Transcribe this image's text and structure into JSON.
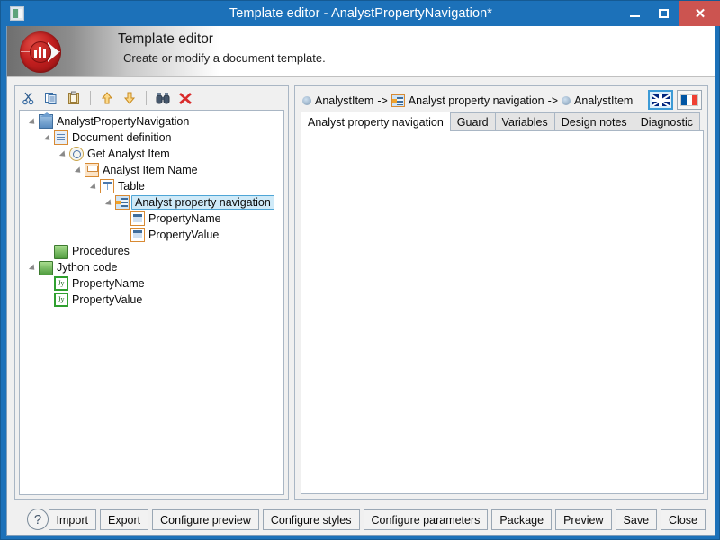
{
  "window": {
    "title": "Template editor - AnalystPropertyNavigation*",
    "icon": "app-icon",
    "minimize_label": "",
    "maximize_label": "",
    "close_label": "✕"
  },
  "banner": {
    "title": "Template editor",
    "subtitle": "Create or modify a document template.",
    "logo": "red-disc-logo"
  },
  "tree_toolbar": {
    "items": [
      {
        "name": "cut-icon",
        "glyph": "✂"
      },
      {
        "name": "copy-icon",
        "glyph": "⧉"
      },
      {
        "name": "paste-icon",
        "glyph": "Ὄb"
      },
      {
        "name": "move-up-icon",
        "glyph": "⇧"
      },
      {
        "name": "move-down-icon",
        "glyph": "⇩"
      },
      {
        "name": "find-icon",
        "glyph": "⚲"
      },
      {
        "name": "delete-icon",
        "glyph": "✖"
      }
    ]
  },
  "tree": {
    "nodes": [
      {
        "label": "AnalystPropertyNavigation",
        "depth": 0,
        "icon": "root-icon",
        "expanded": true,
        "selected": false
      },
      {
        "label": "Document definition",
        "depth": 1,
        "icon": "document-icon",
        "expanded": true,
        "selected": false
      },
      {
        "label": "Get Analyst Item",
        "depth": 2,
        "icon": "query-icon",
        "expanded": true,
        "selected": false
      },
      {
        "label": "Analyst Item Name",
        "depth": 3,
        "icon": "output-icon",
        "expanded": true,
        "selected": false
      },
      {
        "label": "Table",
        "depth": 4,
        "icon": "table-icon",
        "expanded": true,
        "selected": false
      },
      {
        "label": "Analyst property navigation",
        "depth": 5,
        "icon": "navigation-icon",
        "expanded": true,
        "selected": true
      },
      {
        "label": "PropertyName",
        "depth": 6,
        "icon": "field-icon",
        "expanded": false,
        "selected": false
      },
      {
        "label": "PropertyValue",
        "depth": 6,
        "icon": "field-icon",
        "expanded": false,
        "selected": false
      },
      {
        "label": "Procedures",
        "depth": 1,
        "icon": "folder-icon",
        "expanded": false,
        "selected": false
      },
      {
        "label": "Jython code",
        "depth": 0,
        "icon": "folder-icon",
        "expanded": true,
        "selected": false
      },
      {
        "label": "PropertyName",
        "depth": 1,
        "icon": "jython-icon",
        "expanded": false,
        "selected": false,
        "badge": "Jy"
      },
      {
        "label": "PropertyValue",
        "depth": 1,
        "icon": "jython-icon",
        "expanded": false,
        "selected": false,
        "badge": "Jy"
      }
    ]
  },
  "breadcrumb": {
    "part1": "AnalystItem",
    "arrow1": "->",
    "part2": "Analyst property navigation",
    "arrow2": "->",
    "part3": "AnalystItem"
  },
  "language_buttons": [
    {
      "name": "flag-uk",
      "label": "English",
      "active": true
    },
    {
      "name": "flag-fr",
      "label": "French",
      "active": false
    }
  ],
  "tabs": [
    {
      "label": "Analyst property navigation",
      "active": true
    },
    {
      "label": "Guard",
      "active": false
    },
    {
      "label": "Variables",
      "active": false
    },
    {
      "label": "Design notes",
      "active": false
    },
    {
      "label": "Diagnostic",
      "active": false
    }
  ],
  "tab_content": {
    "text": ""
  },
  "bottom": {
    "help_glyph": "?",
    "buttons": [
      "Import",
      "Export",
      "Configure preview",
      "Configure styles",
      "Configure parameters",
      "Package",
      "Preview",
      "Save",
      "Close"
    ]
  },
  "colors": {
    "titlebar": "#1c71b9",
    "close_button": "#cc5450",
    "selection": "#cfeaf8",
    "selection_border": "#4ea5d6",
    "panel_bg": "#f0f0f0",
    "content_bg": "#ffffff"
  }
}
